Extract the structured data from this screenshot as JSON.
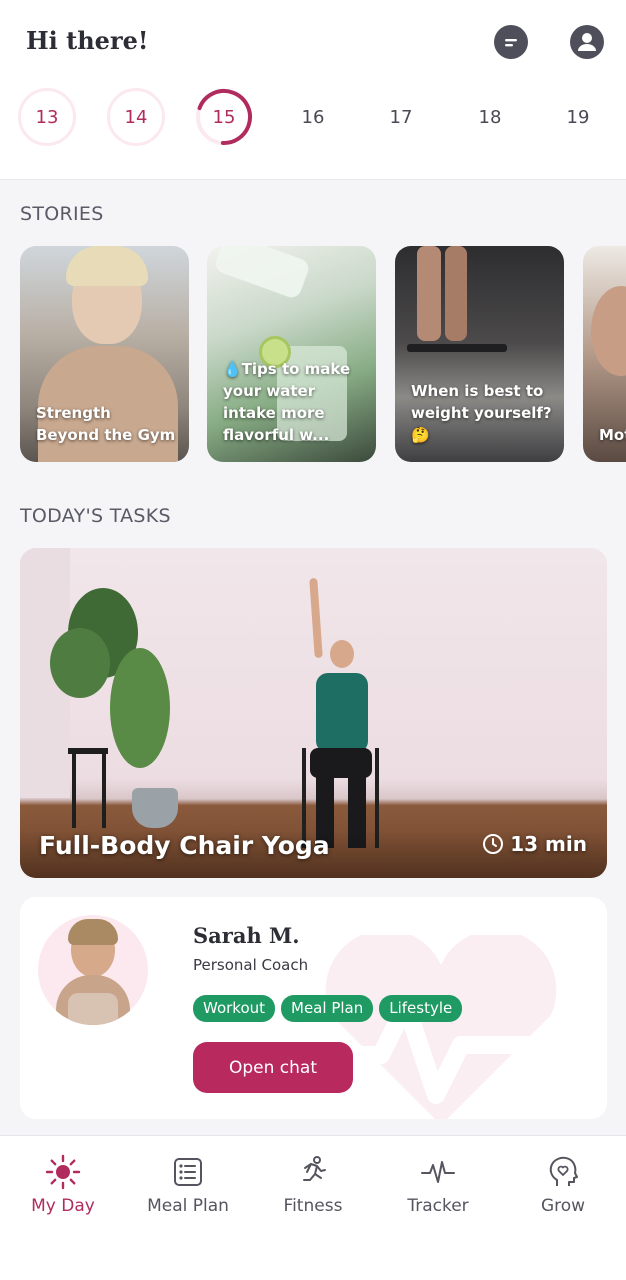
{
  "header": {
    "greeting": "Hi there!",
    "chat_icon": "chat-bubble-icon",
    "profile_icon": "user-profile-icon"
  },
  "dates": [
    {
      "day": "13",
      "state": "past"
    },
    {
      "day": "14",
      "state": "past"
    },
    {
      "day": "15",
      "state": "today",
      "progress": 0.7
    },
    {
      "day": "16",
      "state": "future"
    },
    {
      "day": "17",
      "state": "future"
    },
    {
      "day": "18",
      "state": "future"
    },
    {
      "day": "19",
      "state": "future"
    }
  ],
  "stories": {
    "title": "STORIES",
    "items": [
      {
        "caption": "Strength Beyond the Gym"
      },
      {
        "caption": "💧Tips to make your water intake more flavorful w..."
      },
      {
        "caption": "When is best to weight yourself? 🤔"
      },
      {
        "caption": "Mot tric"
      }
    ]
  },
  "tasks": {
    "title": "TODAY'S TASKS",
    "workout": {
      "title": "Full-Body Chair Yoga",
      "duration": "13 min"
    }
  },
  "coach": {
    "name": "Sarah M.",
    "role": "Personal Coach",
    "tags": [
      "Workout",
      "Meal Plan",
      "Lifestyle"
    ],
    "button": "Open chat"
  },
  "tabbar": {
    "items": [
      {
        "label": "My Day",
        "icon": "sun-icon",
        "active": true
      },
      {
        "label": "Meal Plan",
        "icon": "list-icon",
        "active": false
      },
      {
        "label": "Fitness",
        "icon": "running-icon",
        "active": false
      },
      {
        "label": "Tracker",
        "icon": "pulse-icon",
        "active": false
      },
      {
        "label": "Grow",
        "icon": "head-heart-icon",
        "active": false
      }
    ]
  },
  "colors": {
    "accent": "#b8295e",
    "tag_green": "#1f9a63",
    "text_dark": "#2d2d35"
  }
}
